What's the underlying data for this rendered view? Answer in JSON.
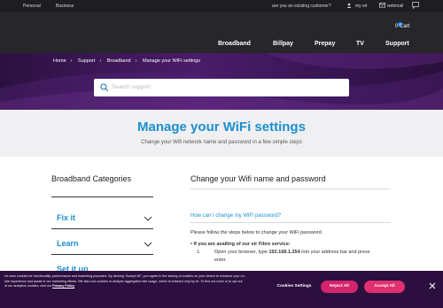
{
  "topbar": {
    "personal": "Personal",
    "business": "Business",
    "existing_customer": "are you an existing customer?",
    "my_eir": "my eir",
    "webmail": "webmail"
  },
  "nav": {
    "items": [
      "Broadband",
      "Billpay",
      "Prepay",
      "TV",
      "Support"
    ],
    "cart_label": "Cart",
    "cart_count": "0"
  },
  "breadcrumb": [
    "Home",
    "Support",
    "Broadband",
    "Manage your WiFi settings"
  ],
  "search": {
    "placeholder": "Search support"
  },
  "title_band": {
    "title": "Manage your WiFi settings",
    "subtitle": "Change your Wifi network name and password in a few simple steps"
  },
  "sidebar": {
    "title": "Broadband Categories",
    "items": [
      "Fix it",
      "Learn",
      "Set it up"
    ]
  },
  "main": {
    "title": "Change your Wifi name and password",
    "faq_link": "How can I change my WiFi password?",
    "intro": "Please follow the steps below to change your WiFi password.",
    "bullet": "If you are availing of our eir Fibre service:",
    "step_num": "1.",
    "step_pre": "Open your browser, type ",
    "step_ip": "192.168.1.254",
    "step_post": " into your address bar and press",
    "step_cont": "enter."
  },
  "cookie": {
    "text": "eir uses cookies for functionality, performance and marketing purposes. By clicking \"Accept All\", you agree to the storing of cookies on your device to enhance your on-site experience and assist in our marketing efforts. We also use cookies to analyse aggregated site usage, which is retained only by eir. To find out more or to opt out of our analytics cookies, visit our",
    "policy_link": "Privacy Policy",
    "settings": "Cookies Settings",
    "reject": "Reject All",
    "accept": "Accept All"
  },
  "colors": {
    "accent_blue": "#1b8fd0",
    "header_dark": "#26262b",
    "hero_purple": "#4a1d6a",
    "cookie_bg": "#2c0e3f",
    "reject_btn": "#d4256c",
    "accept_btn": "#e0306f"
  }
}
